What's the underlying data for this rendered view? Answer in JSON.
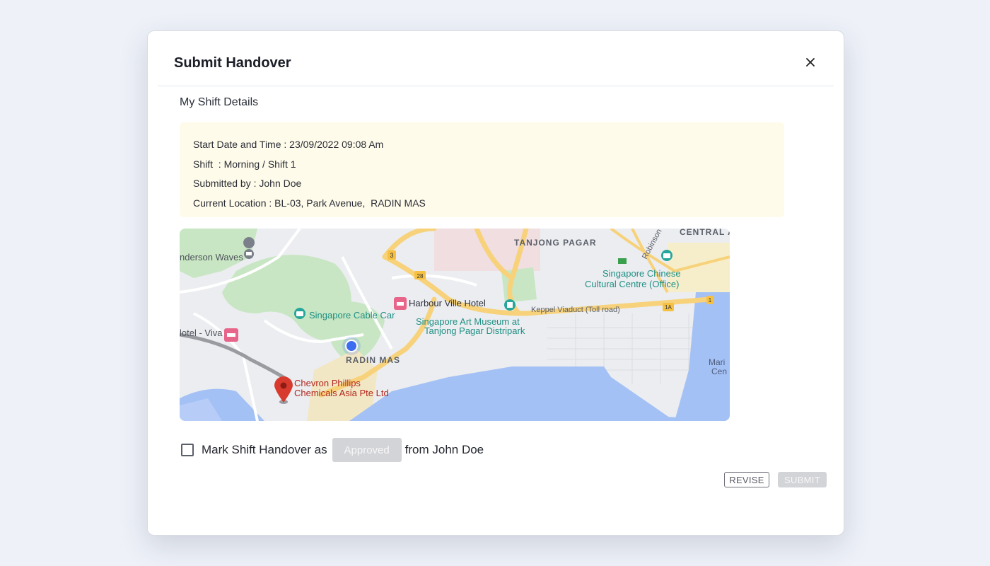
{
  "modal": {
    "title": "Submit Handover",
    "close_icon": "close-icon"
  },
  "shift_details": {
    "section_title": "My Shift Details",
    "rows": [
      "Start Date and Time : 23/09/2022 09:08 Am",
      "Shift  : Morning / Shift 1",
      "Submitted by : John Doe",
      "Current Location : BL-03, Park Avenue,  RADIN MAS"
    ]
  },
  "map": {
    "labels": {
      "central": "CENTRAL A",
      "tanjong_pagar": "TANJONG PAGAR",
      "robinson": "Robinson",
      "henderson_waves": "nderson Waves",
      "scc_line1": "Singapore Chinese",
      "scc_line2": "Cultural Centre (Office)",
      "harbour_ville": "Harbour Ville Hotel",
      "keppel_viaduct": "Keppel Viaduct (Toll road)",
      "cable_car": "Singapore Cable Car",
      "sam_line1": "Singapore Art Museum at",
      "sam_line2": "Tanjong Pagar Distripark",
      "hotel_viva": "lotel - Viva",
      "radin_mas": "RADIN MAS",
      "chevron_line1": "Chevron Phillips",
      "chevron_line2": "Chemicals Asia Pte Ltd",
      "marina_line1": "Mari",
      "marina_line2": "Cen",
      "road_3": "3",
      "road_28": "28",
      "road_1": "1",
      "road_1a": "1A"
    },
    "colors": {
      "water": "#a4c1f6",
      "park": "#c8e6c3",
      "road": "#f7d27a",
      "pin": "#d93a2e",
      "location_dot": "#3d6cf0"
    }
  },
  "approve": {
    "prefix": "Mark Shift Handover as",
    "status_label": "Approved",
    "suffix": "from John Doe"
  },
  "actions": {
    "revise_label": "REVISE",
    "submit_label": "SUBMIT"
  }
}
